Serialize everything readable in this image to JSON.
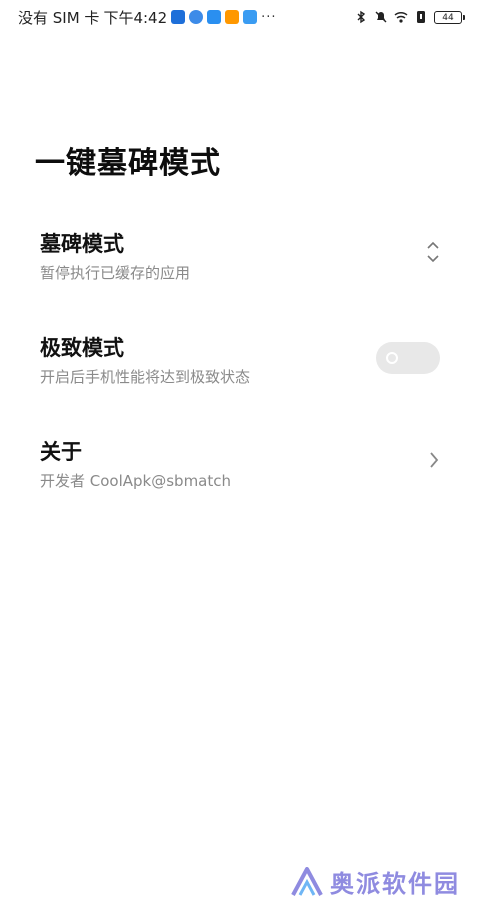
{
  "status_bar": {
    "carrier": "没有 SIM 卡",
    "time": "下午4:42",
    "app_icons": [
      "app-notify-icon",
      "browser-icon",
      "app-book-icon",
      "play-icon",
      "cloud-icon"
    ],
    "more": "···",
    "battery": "44",
    "right_icons": [
      "bluetooth-icon",
      "mute-bell-icon",
      "wifi-icon",
      "battery-saver-icon"
    ]
  },
  "page": {
    "title": "一键墓碑模式"
  },
  "settings": [
    {
      "title": "墓碑模式",
      "subtitle": "暂停执行已缓存的应用",
      "control": "up-down-chevron-icon"
    },
    {
      "title": "极致模式",
      "subtitle": "开启后手机性能将达到极致状态",
      "control": "toggle",
      "enabled": false
    },
    {
      "title": "关于",
      "subtitle": "开发者 CoolApk@sbmatch",
      "control": "chevron-right-icon"
    }
  ],
  "watermark": {
    "logo": "aopai-logo-icon",
    "text": "奥派软件园"
  },
  "colors": {
    "background": "#ffffff",
    "title": "#0d0d0d",
    "subtitle": "#8a8a8a",
    "toggle_off": "#e8e8e8",
    "watermark": "#8f8be0",
    "app_icon_blue": "#1e88e5",
    "app_icon_orange": "#ff9800"
  }
}
